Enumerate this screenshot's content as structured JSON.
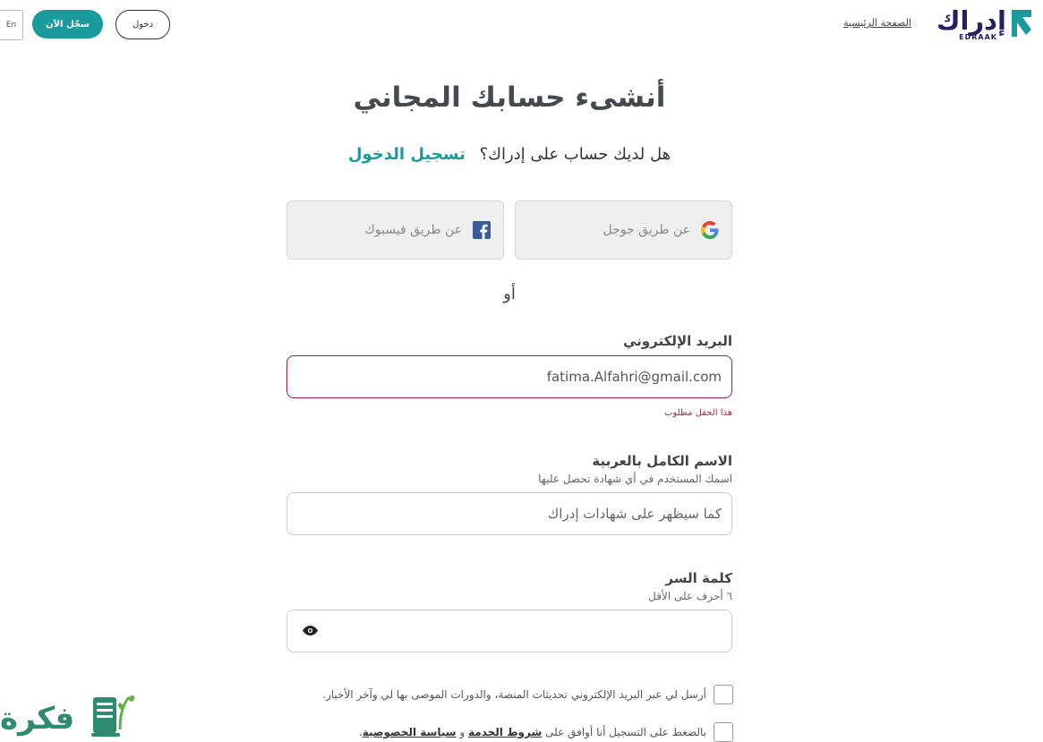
{
  "header": {
    "lang_label": "En",
    "signup_label": "سجّل الآن",
    "login_label": "دخول",
    "home_link": "الصفحة الرئيسية",
    "logo_text": "إدراك",
    "logo_latin": "EDRAAK"
  },
  "main": {
    "title": "أنشىء حسابك المجاني",
    "have_account_text": "هل لديك حساب على إدراك؟",
    "login_link": "تسجيل الدخول",
    "google_label": "عن طريق جوجل",
    "facebook_label": "عن طريق فيسبوك",
    "or_text": "أو"
  },
  "form": {
    "email": {
      "label": "البريد الإلكتروني",
      "value": "fatima.Alfahri@gmail.com",
      "error": "هذا الحقل مطلوب"
    },
    "full_name": {
      "label": "الاسم الكامل بالعربية",
      "hint": "اسمك المستخدم في أي شهادة تحصل عليها",
      "placeholder": "كما سيظهر على شهادات إدراك"
    },
    "password": {
      "label": "كلمة السر",
      "hint": "٦ أحرف على الأقل",
      "value": ""
    },
    "newsletter_text": "أرسل لي عبر البريد الإلكتروني تحديثات المنصة، والدورات الموصى بها لي وآخر الأخبار.",
    "terms_prefix": "بالضغط على التسجيل أنا أوافق على",
    "terms_link": "شروط الخدمة",
    "terms_and": "و",
    "privacy_link": "سياسة الخصوصية",
    "terms_suffix": "."
  },
  "watermark": {
    "text": "فكرة"
  },
  "colors": {
    "accent": "#1a9a9d",
    "brand": "#232064",
    "error": "#b0274a"
  }
}
